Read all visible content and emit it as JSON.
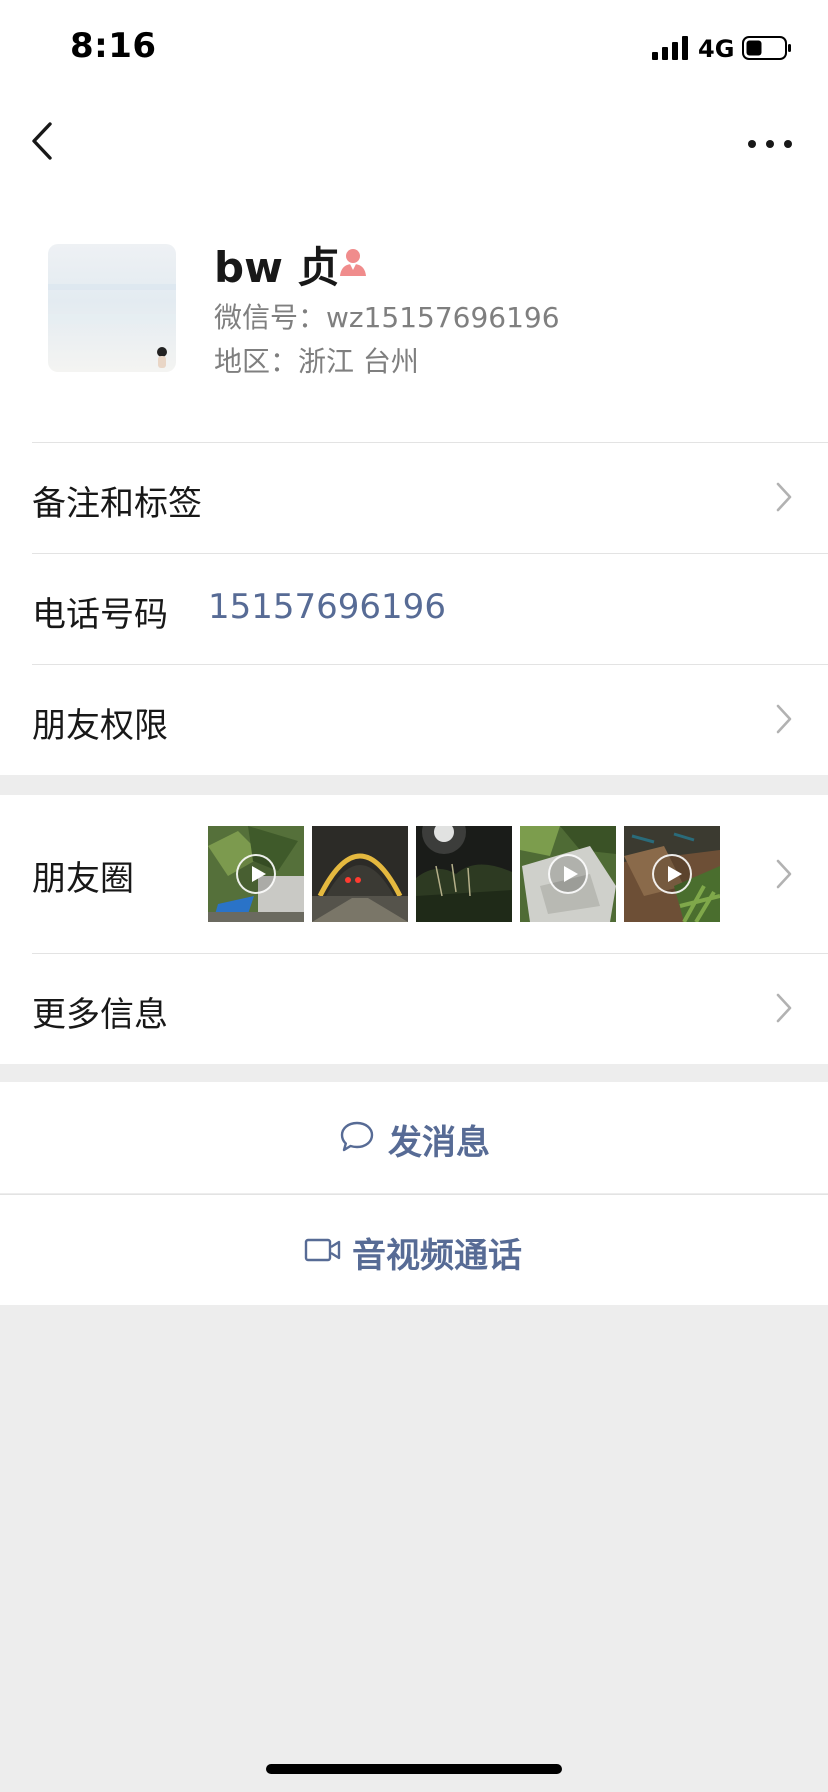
{
  "status_bar": {
    "time": "8:16",
    "network": "4G",
    "signal_icon": "cellular-signal-icon",
    "battery_icon": "battery-icon"
  },
  "nav": {
    "back_icon": "chevron-left-icon",
    "more_icon": "more-horizontal-icon"
  },
  "profile": {
    "name": "bw 贞",
    "gender_icon": "female-icon",
    "wechat_id": "微信号：wz15157696196",
    "region": "地区：浙江 台州"
  },
  "rows": {
    "remarks_label": "备注和标签",
    "phone_label": "电话号码",
    "phone_value": "15157696196",
    "permissions_label": "朋友权限",
    "moments_label": "朋友圈",
    "more_info_label": "更多信息"
  },
  "actions": {
    "message_label": "发消息",
    "message_icon": "chat-bubble-icon",
    "call_label": "音视频通话",
    "call_icon": "video-camera-icon"
  },
  "colors": {
    "link_blue": "#576b95",
    "background": "#ededed",
    "female_icon": "#f08c8c"
  }
}
